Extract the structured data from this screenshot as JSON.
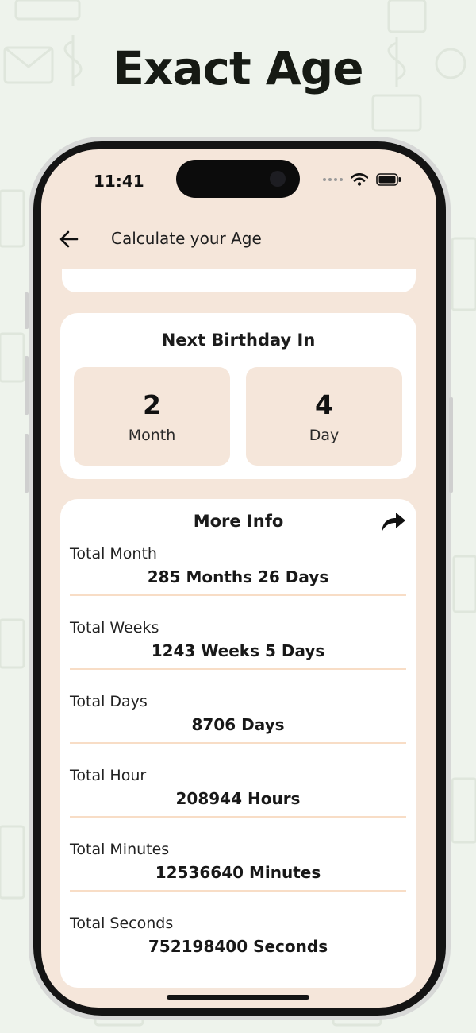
{
  "promo": {
    "title": "Exact Age"
  },
  "status_bar": {
    "time": "11:41",
    "icons": [
      "wifi-icon",
      "battery-icon"
    ]
  },
  "app_bar": {
    "title": "Calculate your Age",
    "back_icon": "arrow-left-icon"
  },
  "next_birthday": {
    "heading": "Next Birthday In",
    "items": [
      {
        "value": "2",
        "unit": "Month"
      },
      {
        "value": "4",
        "unit": "Day"
      }
    ]
  },
  "more_info": {
    "heading": "More Info",
    "share_icon": "share-arrow-icon",
    "rows": [
      {
        "label": "Total Month",
        "value": "285 Months 26 Days"
      },
      {
        "label": "Total Weeks",
        "value": "1243 Weeks 5 Days"
      },
      {
        "label": "Total Days",
        "value": "8706 Days"
      },
      {
        "label": "Total Hour",
        "value": "208944 Hours"
      },
      {
        "label": "Total Minutes",
        "value": "12536640 Minutes"
      },
      {
        "label": "Total Seconds",
        "value": "752198400 Seconds"
      }
    ]
  },
  "colors": {
    "background": "#eef3ec",
    "screen": "#f5e6da",
    "card": "#ffffff",
    "divider": "#f8ddc6",
    "text": "#161a14"
  }
}
